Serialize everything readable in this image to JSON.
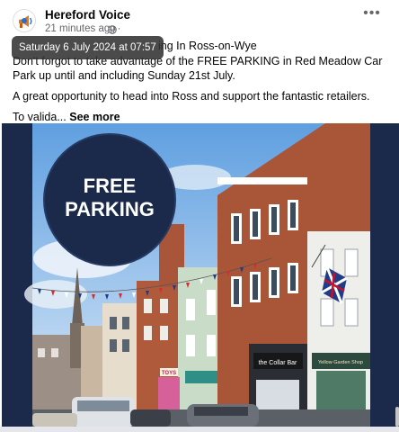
{
  "post": {
    "page_name": "Hereford Voice",
    "time_ago": "21 minutes ago",
    "separator": "·",
    "more_label": "•••",
    "tooltip": "Saturday 6 July 2024 at 07:57",
    "headline_visible": "ing In Ross-on-Wye",
    "paragraph_1": "Don't forgot to take advantage of the FREE PARKING in Red Meadow Car Park up until and including Sunday 21st July.",
    "paragraph_2": "A great opportunity to head into Ross and support the fantastic retailers.",
    "paragraph_3_start": "To valida...",
    "see_more": "See more"
  },
  "image": {
    "badge_line_1": "FREE",
    "badge_line_2": "PARKING",
    "badge_color": "#1b2a4a",
    "sign_collar_bar": "the Collar Bar",
    "sign_toys": "TOYS",
    "sign_shop": "Yellow Garden Shop"
  },
  "icons": {
    "avatar": "megaphone-icon",
    "privacy": "globe-icon",
    "more": "ellipsis-icon"
  }
}
